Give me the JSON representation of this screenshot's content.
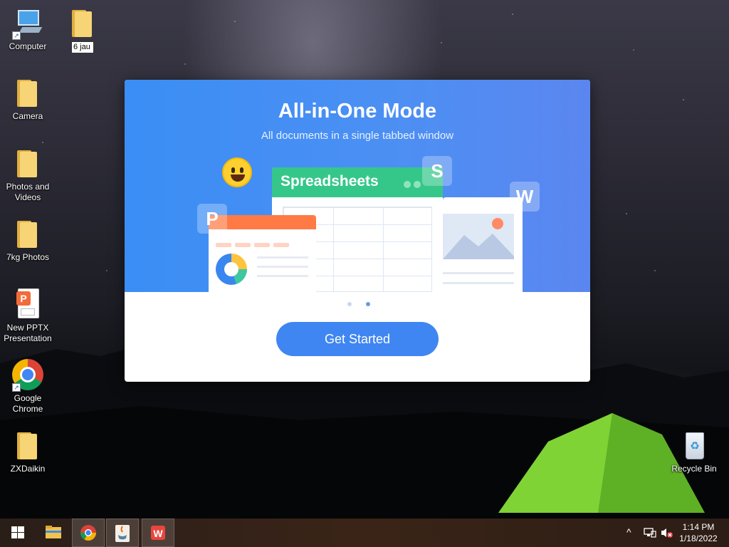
{
  "desktop": {
    "icons": [
      {
        "label": "Computer",
        "type": "computer"
      },
      {
        "label": "6 jau",
        "type": "folder-renaming"
      },
      {
        "label": "Camera",
        "type": "folder"
      },
      {
        "label": "Photos and Videos",
        "type": "folder"
      },
      {
        "label": "7kg Photos",
        "type": "folder"
      },
      {
        "label": "New PPTX Presentation",
        "type": "pptx-file"
      },
      {
        "label": "Google Chrome",
        "type": "chrome"
      },
      {
        "label": "ZXDaikin",
        "type": "folder"
      },
      {
        "label": "Recycle Bin",
        "type": "recycle-bin"
      }
    ]
  },
  "dialog": {
    "title": "All-in-One Mode",
    "subtitle": "All documents in a single tabbed window",
    "illustration": {
      "spreadsheet_label": "Spreadsheets",
      "badges": {
        "spreadsheet": "S",
        "writer": "W",
        "presentation": "P"
      }
    },
    "pager": {
      "count": 2,
      "active_index": 1
    },
    "button_label": "Get Started",
    "colors": {
      "banner": "#3a8ef5",
      "button": "#3f86f2",
      "sheet_green": "#35c78a",
      "pres_orange": "#ff7a45"
    }
  },
  "taskbar": {
    "apps": [
      {
        "name": "start",
        "icon": "windows-logo-icon"
      },
      {
        "name": "file-explorer",
        "icon": "folder-icon"
      },
      {
        "name": "chrome",
        "icon": "chrome-icon"
      },
      {
        "name": "java",
        "icon": "java-icon"
      },
      {
        "name": "wps-office",
        "icon": "wps-icon"
      }
    ],
    "clock_time": "1:14 PM",
    "clock_date": "1/18/2022"
  }
}
